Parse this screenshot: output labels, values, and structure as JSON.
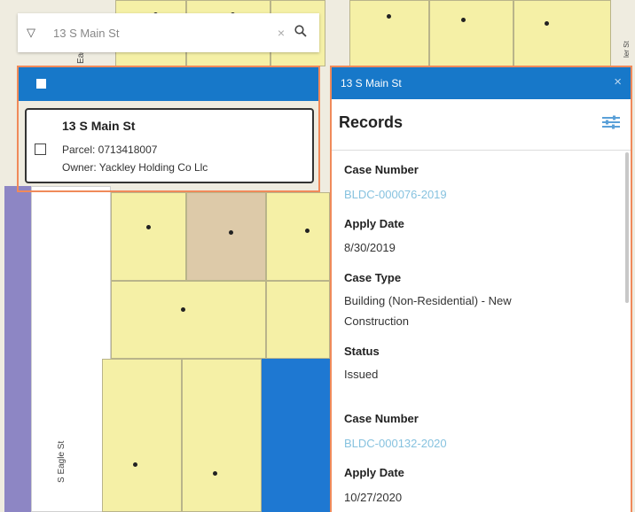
{
  "search": {
    "value": "13 S Main St",
    "clear_glyph": "×"
  },
  "streets": {
    "left_top": "Eagle",
    "left_bottom": "S Eagle St",
    "right_top": "ler St"
  },
  "results": {
    "card": {
      "address": "13 S Main St",
      "parcel": "Parcel: 0713418007",
      "owner": "Owner: Yackley Holding Co Llc"
    }
  },
  "details": {
    "title": "13 S Main St",
    "close_glyph": "×",
    "section_title": "Records",
    "records": [
      {
        "case_number_label": "Case Number",
        "case_number": "BLDC-000076-2019",
        "apply_date_label": "Apply Date",
        "apply_date": "8/30/2019",
        "case_type_label": "Case Type",
        "case_type_line1": "Building (Non-Residential) - New",
        "case_type_line2": "Construction",
        "status_label": "Status",
        "status": "Issued"
      },
      {
        "case_number_label": "Case Number",
        "case_number": "BLDC-000132-2020",
        "apply_date_label": "Apply Date",
        "apply_date": "10/27/2020"
      }
    ]
  },
  "colors": {
    "header": "#1778c9",
    "parcel": "#f5f0a6",
    "highlight": "#1e78d2",
    "link": "#86c2df",
    "outline": "#f08a5a"
  }
}
